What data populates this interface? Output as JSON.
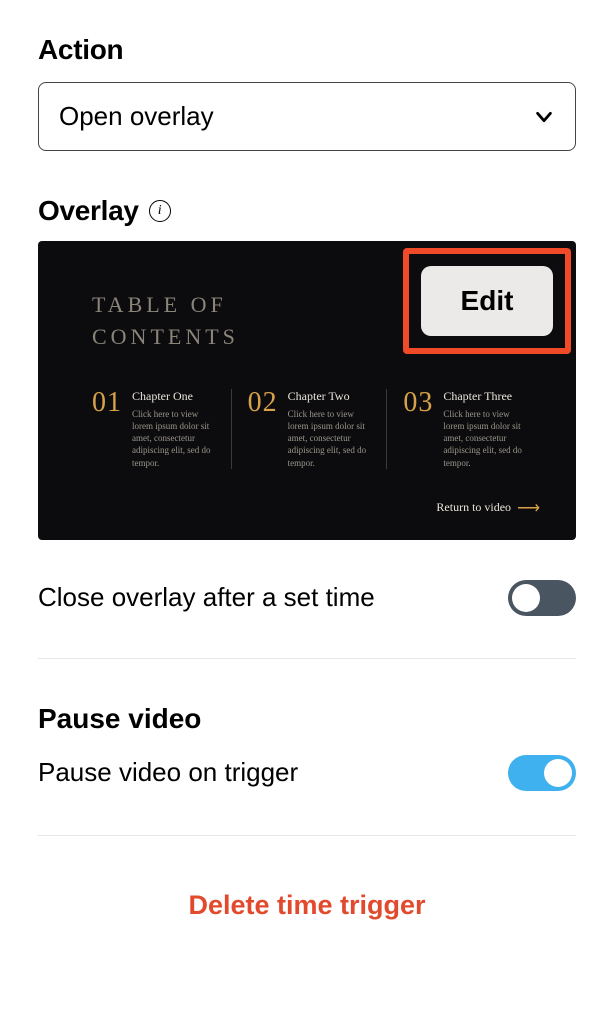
{
  "action": {
    "label": "Action",
    "selected": "Open overlay"
  },
  "overlay": {
    "label": "Overlay",
    "edit_label": "Edit",
    "toc_line1": "TABLE OF",
    "toc_line2": "CONTENTS",
    "chapters": [
      {
        "num": "01",
        "name": "Chapter One",
        "desc": "Click here to view lorem ipsum dolor sit amet, consectetur adipiscing elit, sed do tempor."
      },
      {
        "num": "02",
        "name": "Chapter Two",
        "desc": "Click here to view lorem ipsum dolor sit amet, consectetur adipiscing elit, sed do tempor."
      },
      {
        "num": "03",
        "name": "Chapter Three",
        "desc": "Click here to view lorem ipsum dolor sit amet, consectetur adipiscing elit, sed do tempor."
      }
    ],
    "return_label": "Return to video"
  },
  "close_after_time": {
    "label": "Close overlay after a set time",
    "enabled": false
  },
  "pause_video": {
    "title": "Pause video",
    "label": "Pause video on trigger",
    "enabled": true
  },
  "delete_label": "Delete time trigger"
}
